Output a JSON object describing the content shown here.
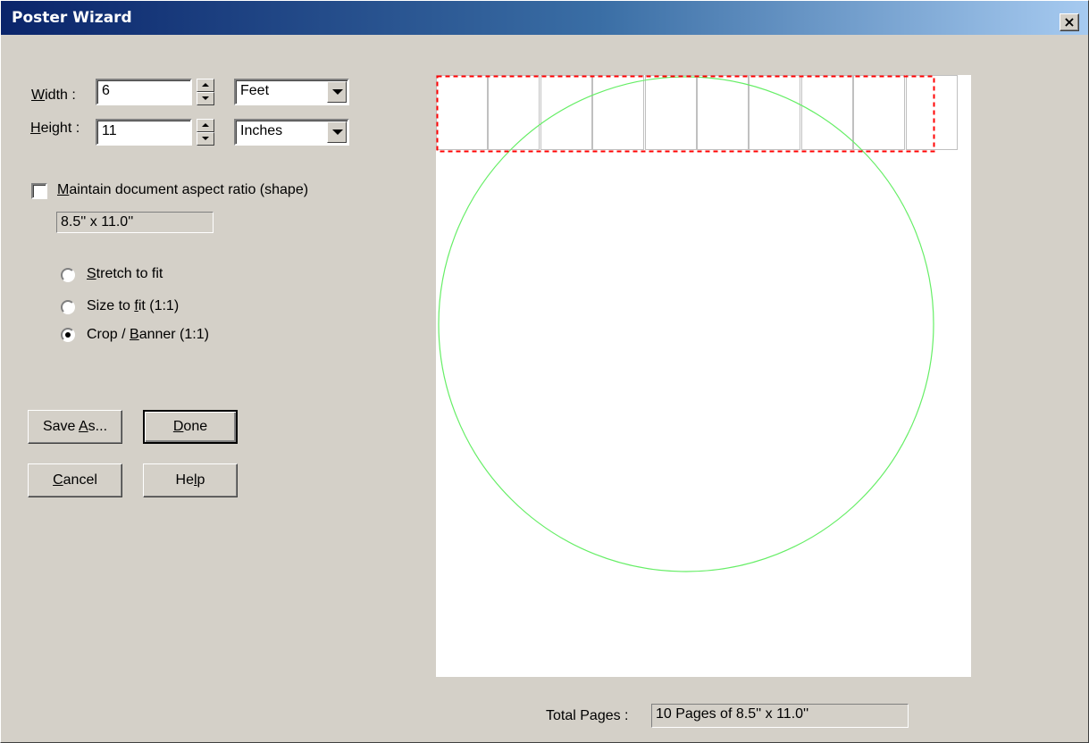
{
  "window": {
    "title": "Poster Wizard",
    "close_label": "×"
  },
  "width": {
    "label_prefix": "",
    "label_accel": "W",
    "label_rest": "idth :",
    "value": "6",
    "unit": "Feet"
  },
  "height": {
    "label_accel": "H",
    "label_rest": "eight :",
    "value": "11",
    "unit": "Inches"
  },
  "aspect": {
    "label_accel": "M",
    "label_rest": "aintain document aspect ratio (shape)",
    "checked": false,
    "doc_size": "8.5'' x 11.0''"
  },
  "fit_options": [
    {
      "pre": "",
      "accel": "S",
      "post": "tretch to fit",
      "selected": false
    },
    {
      "pre": "Size to ",
      "accel": "f",
      "post": "it  (1:1)",
      "selected": false
    },
    {
      "pre": "Crop / ",
      "accel": "B",
      "post": "anner (1:1)",
      "selected": true
    }
  ],
  "buttons": {
    "save_as": {
      "pre": "Save ",
      "accel": "A",
      "post": "s..."
    },
    "done": {
      "pre": "",
      "accel": "D",
      "post": "one"
    },
    "cancel": {
      "pre": "",
      "accel": "C",
      "post": "ancel"
    },
    "help": {
      "pre": "He",
      "accel": "l",
      "post": "p"
    }
  },
  "preview": {
    "page_tiles": 10,
    "tile_line_color": "#c0c0c0",
    "crop_color": "#ff0000",
    "circle_color": "#66ee66"
  },
  "total_pages": {
    "label": "Total Pages :",
    "value": "10 Pages of 8.5'' x 11.0''"
  }
}
